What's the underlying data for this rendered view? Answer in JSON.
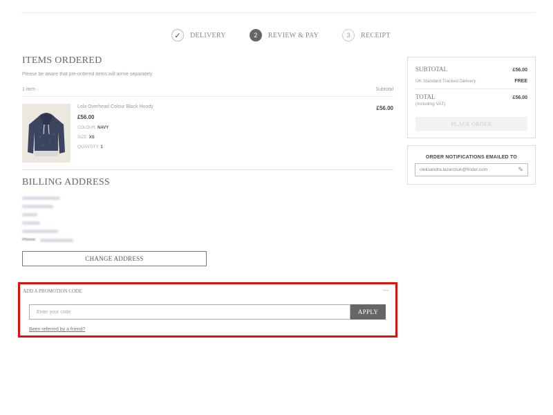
{
  "steps": [
    {
      "label": "DELIVERY",
      "marker": "✓",
      "state": "done"
    },
    {
      "label": "REVIEW & PAY",
      "marker": "2",
      "state": "active"
    },
    {
      "label": "RECEIPT",
      "marker": "3",
      "state": "todo"
    }
  ],
  "items": {
    "heading": "ITEMS ORDERED",
    "note": "Please be aware that pre-ordered items will arrive separately",
    "count": "1 item",
    "subtotal_col": "Subtotal",
    "product": {
      "name": "Lola Overhead Colour Block Hoody",
      "price": "£56.00",
      "colour_label": "COLOUR:",
      "colour": "NAVY",
      "size_label": "SIZE:",
      "size": "XS",
      "qty_label": "QUANTITY:",
      "qty": "1",
      "line_total": "£56.00",
      "image_icon": "hoody-image"
    }
  },
  "billing": {
    "heading": "BILLING ADDRESS",
    "phone_label": "Phone:",
    "change_label": "CHANGE ADDRESS"
  },
  "promo": {
    "title": "ADD A PROMOTION CODE",
    "collapse": "—",
    "placeholder": "Enter your code",
    "apply": "APPLY",
    "referred": "Been referred by a friend?"
  },
  "summary": {
    "subtotal_label": "SUBTOTAL",
    "subtotal_value": "£56.00",
    "delivery_label": "UK Standard Tracked Delivery",
    "delivery_value": "FREE",
    "total_label": "TOTAL",
    "total_value": "£56.00",
    "vat_note": "(including VAT)",
    "place_order": "PLACE ORDER"
  },
  "notify": {
    "title": "ORDER NOTIFICATIONS EMAILED TO",
    "email": "oleksandra.lazarchuk@finder.com",
    "edit_icon": "pencil-icon"
  },
  "colors": {
    "highlight": "#e0100d",
    "button": "#666666",
    "edit_icon": "#5b8fd1"
  }
}
